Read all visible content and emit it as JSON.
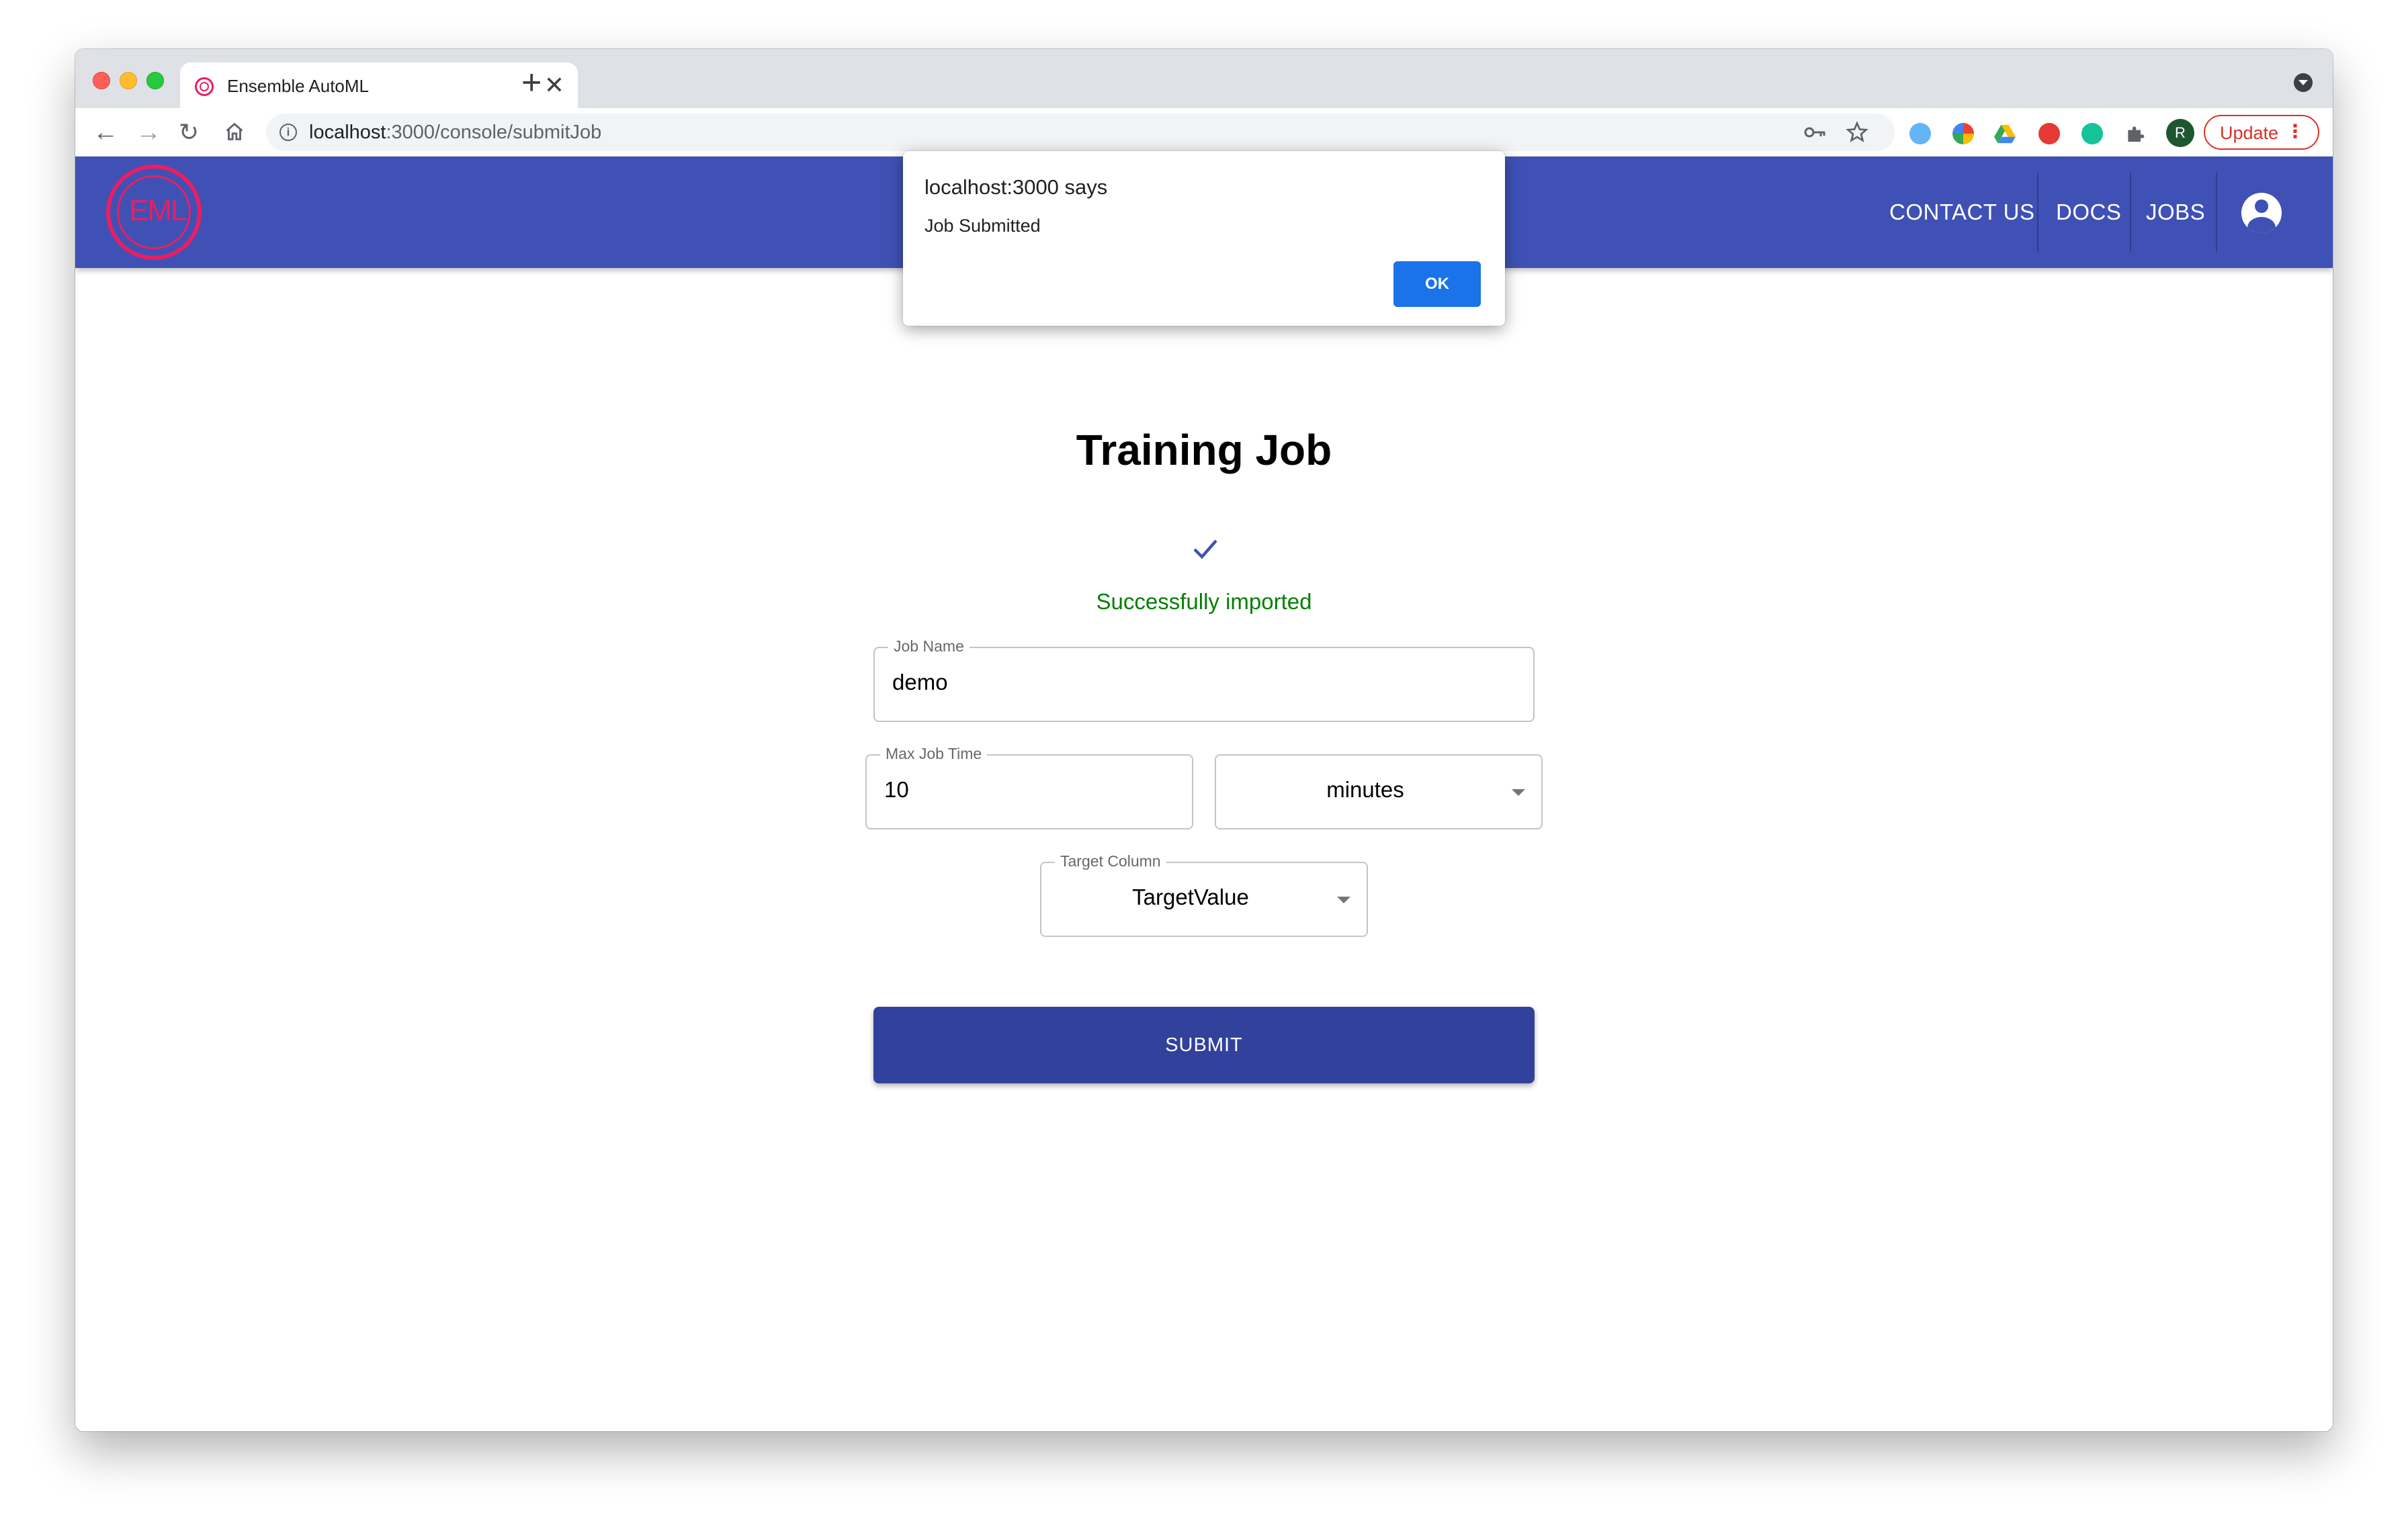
{
  "browser": {
    "tab_title": "Ensemble AutoML",
    "tab_close": "✕",
    "new_tab": "+",
    "url_host": "localhost",
    "url_path": ":3000/console/submitJob",
    "update_label": "Update",
    "profile_initial": "R"
  },
  "app": {
    "logo_text": "EML",
    "nav": {
      "contact": "CONTACT US",
      "docs": "DOCS",
      "jobs": "JOBS"
    }
  },
  "main": {
    "title": "Training Job",
    "status": "Successfully imported",
    "status_color": "#008000",
    "job_name": {
      "label": "Job Name",
      "value": "demo"
    },
    "max_job_time": {
      "label": "Max Job Time",
      "value": "10"
    },
    "time_unit": {
      "value": "minutes"
    },
    "target_column": {
      "label": "Target Column",
      "value": "TargetValue"
    },
    "submit_label": "SUBMIT"
  },
  "dialog": {
    "title": "localhost:3000 says",
    "message": "Job Submitted",
    "ok_label": "OK"
  },
  "colors": {
    "appbar": "#3f51b5",
    "submit": "#32419c",
    "logo": "#e91e63",
    "dialog_ok": "#1a73e8"
  }
}
